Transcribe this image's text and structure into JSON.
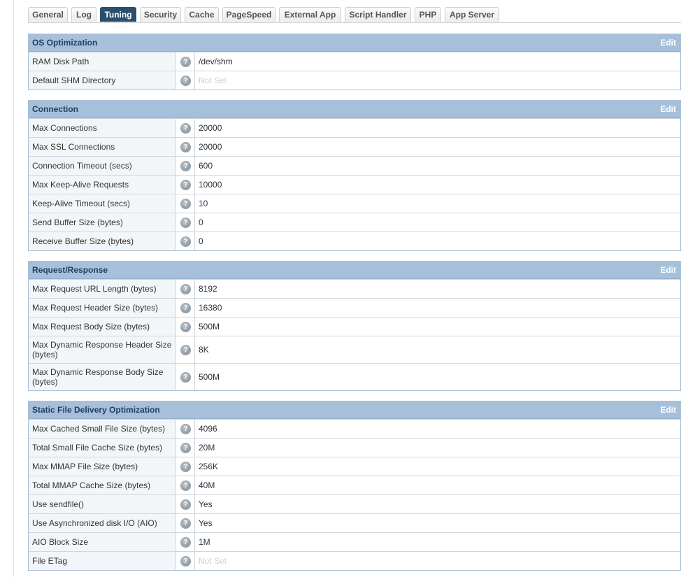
{
  "tabs": [
    {
      "label": "General",
      "active": false
    },
    {
      "label": "Log",
      "active": false
    },
    {
      "label": "Tuning",
      "active": true
    },
    {
      "label": "Security",
      "active": false
    },
    {
      "label": "Cache",
      "active": false
    },
    {
      "label": "PageSpeed",
      "active": false
    },
    {
      "label": "External App",
      "active": false
    },
    {
      "label": "Script Handler",
      "active": false
    },
    {
      "label": "PHP",
      "active": false
    },
    {
      "label": "App Server",
      "active": false
    }
  ],
  "colors": {
    "active_tab": "#2a4f6e",
    "panel_header": "#a6c0dc",
    "label_bg": "#f3f6f9"
  },
  "panels": [
    {
      "title": "OS Optimization",
      "edit_label": "Edit",
      "rows": [
        {
          "label": "RAM Disk Path",
          "value": "/dev/shm",
          "not_set": false
        },
        {
          "label": "Default SHM Directory",
          "value": "Not Set",
          "not_set": true
        }
      ]
    },
    {
      "title": "Connection",
      "edit_label": "Edit",
      "rows": [
        {
          "label": "Max Connections",
          "value": "20000",
          "not_set": false
        },
        {
          "label": "Max SSL Connections",
          "value": "20000",
          "not_set": false
        },
        {
          "label": "Connection Timeout (secs)",
          "value": "600",
          "not_set": false
        },
        {
          "label": "Max Keep-Alive Requests",
          "value": "10000",
          "not_set": false
        },
        {
          "label": "Keep-Alive Timeout (secs)",
          "value": "10",
          "not_set": false
        },
        {
          "label": "Send Buffer Size (bytes)",
          "value": "0",
          "not_set": false
        },
        {
          "label": "Receive Buffer Size (bytes)",
          "value": "0",
          "not_set": false
        }
      ]
    },
    {
      "title": "Request/Response",
      "edit_label": "Edit",
      "rows": [
        {
          "label": "Max Request URL Length (bytes)",
          "value": "8192",
          "not_set": false
        },
        {
          "label": "Max Request Header Size (bytes)",
          "value": "16380",
          "not_set": false
        },
        {
          "label": "Max Request Body Size (bytes)",
          "value": "500M",
          "not_set": false
        },
        {
          "label": "Max Dynamic Response Header Size (bytes)",
          "value": "8K",
          "not_set": false
        },
        {
          "label": "Max Dynamic Response Body Size (bytes)",
          "value": "500M",
          "not_set": false
        }
      ]
    },
    {
      "title": "Static File Delivery Optimization",
      "edit_label": "Edit",
      "rows": [
        {
          "label": "Max Cached Small File Size (bytes)",
          "value": "4096",
          "not_set": false
        },
        {
          "label": "Total Small File Cache Size (bytes)",
          "value": "20M",
          "not_set": false
        },
        {
          "label": "Max MMAP File Size (bytes)",
          "value": "256K",
          "not_set": false
        },
        {
          "label": "Total MMAP Cache Size (bytes)",
          "value": "40M",
          "not_set": false
        },
        {
          "label": "Use sendfile()",
          "value": "Yes",
          "not_set": false
        },
        {
          "label": "Use Asynchronized disk I/O (AIO)",
          "value": "Yes",
          "not_set": false
        },
        {
          "label": "AIO Block Size",
          "value": "1M",
          "not_set": false
        },
        {
          "label": "File ETag",
          "value": "Not Set",
          "not_set": true
        }
      ]
    }
  ]
}
